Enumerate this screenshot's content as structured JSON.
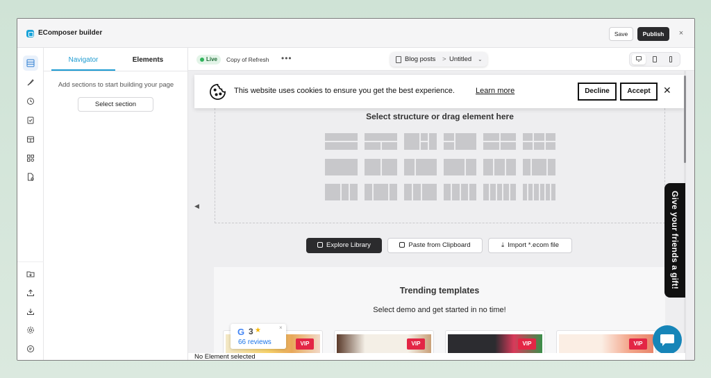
{
  "app": {
    "title": "EComposer builder",
    "save_label": "Save",
    "publish_label": "Publish",
    "close_label": "×"
  },
  "rail": {
    "top_icons": [
      "sections-icon",
      "brush-icon",
      "history-icon",
      "clipboard-check-icon",
      "box-icon",
      "apps-icon",
      "file-settings-icon"
    ],
    "bottom_icons": [
      "folder-import-icon",
      "upload-icon",
      "download-icon",
      "settings-icon",
      "chat-help-icon"
    ]
  },
  "panel": {
    "tabs": [
      {
        "label": "Navigator",
        "active": true
      },
      {
        "label": "Elements",
        "active": false
      }
    ],
    "hint": "Add sections to start building your page",
    "select_button": "Select section"
  },
  "canvas": {
    "live_label": "Live",
    "page_name": "Copy of Refresh",
    "more_label": "•••",
    "breadcrumb": {
      "section": "Blog posts",
      "separator": ">",
      "item": "Untitled"
    },
    "collapse_arrow": "◀"
  },
  "cookie": {
    "text": "This website uses cookies to ensure you get the best experience.",
    "link": "Learn more",
    "decline": "Decline",
    "accept": "Accept",
    "close": "✕"
  },
  "dropzone": {
    "title": "Select structure or drag element here"
  },
  "actions": {
    "explore": "Explore Library",
    "paste": "Paste from Clipboard",
    "import": "Import *.ecom file"
  },
  "trending": {
    "title": "Trending templates",
    "subtitle": "Select demo and get started in no time!",
    "badge": "VIP"
  },
  "reviews": {
    "rating": "3",
    "star": "★",
    "count": "66 reviews",
    "close": "×"
  },
  "gift": {
    "label": "Give your friends a gift!"
  },
  "status": {
    "text": "No Element selected"
  },
  "colors": {
    "accent": "#1d9bd1",
    "dark": "#2b2b2d",
    "vip": "#e32645",
    "chat": "#1685b8",
    "live": "#2fb35b"
  }
}
